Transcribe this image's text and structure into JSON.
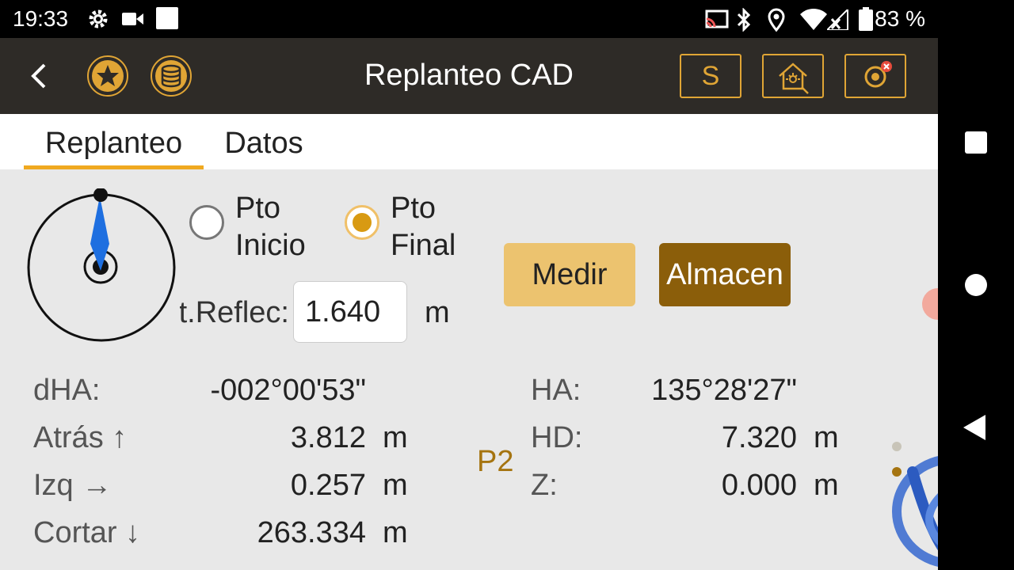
{
  "status_bar": {
    "time": "19:33",
    "battery": "83 %"
  },
  "app_bar": {
    "title": "Replanteo CAD",
    "s_button": "S"
  },
  "tabs": [
    "Replanteo",
    "Datos"
  ],
  "controls": {
    "radio_start": {
      "line1": "Pto",
      "line2": "Inicio",
      "selected": false
    },
    "radio_end": {
      "line1": "Pto",
      "line2": "Final",
      "selected": true
    },
    "measure_button": "Medir",
    "store_button": "Almacen",
    "reflector_label": "t.Reflec:",
    "reflector_value": "1.640",
    "reflector_unit": "m"
  },
  "readout": {
    "dha": {
      "label": "dHA:",
      "value": "-002°00'53\""
    },
    "atras": {
      "label": "Atrás ↑",
      "value": "3.812",
      "unit": "m"
    },
    "izq": {
      "label": "Izq →",
      "value": "0.257",
      "unit": "m"
    },
    "cortar": {
      "label": "Cortar ↓",
      "value": "263.334",
      "unit": "m"
    },
    "point": "P2",
    "ha": {
      "label": "HA:",
      "value": "135°28'27\""
    },
    "hd": {
      "label": "HD:",
      "value": "7.320",
      "unit": "m"
    },
    "z": {
      "label": "Z:",
      "value": "0.000",
      "unit": "m"
    }
  },
  "colors": {
    "accent": "#f0a920",
    "appbar": "#2e2b27",
    "measure": "#ecc36f",
    "store": "#8b5e0a",
    "compass_needle": "#1e6fe0",
    "point_label": "#a57410"
  },
  "watermark": "VGC"
}
